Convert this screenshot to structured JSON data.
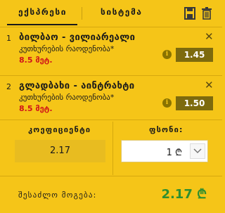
{
  "tabs": {
    "express": "ექსპრესი",
    "system": "სისტემა"
  },
  "toolbar": {
    "save_icon": "save-icon",
    "trash_icon": "trash-icon"
  },
  "bets": [
    {
      "number": "1",
      "title": "ბილბაო - ვილიარეალი",
      "market": "კუთხურების რაოდენობა*",
      "selection": "8.5 მეტ.",
      "odds": "1.45"
    },
    {
      "number": "2",
      "title": "გლადბახი - აინტრახტი",
      "market": "კუთხურების რაოდენობა*",
      "selection": "8.5 მეტ.",
      "odds": "1.50"
    }
  ],
  "coefficient": {
    "label": "კოეფიციენტი",
    "value": "2.17"
  },
  "stake": {
    "label": "ფსონი:",
    "value": "1 ₾"
  },
  "win": {
    "label": "შესაძლო მოგება:",
    "value": "2.17 ₾"
  },
  "colors": {
    "background": "#f5c518",
    "odds_badge": "#7d6a0d",
    "selection_red": "#d0141a",
    "win_green": "#2f8f2f"
  }
}
